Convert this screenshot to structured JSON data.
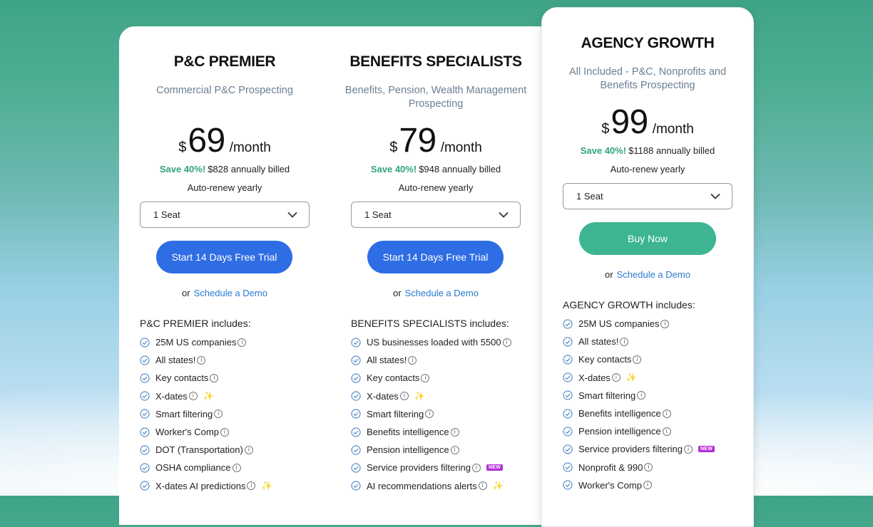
{
  "colors": {
    "save_green": "#2ea37e",
    "link_blue": "#2a7ad0",
    "cta_blue": "#2f6de5",
    "cta_green": "#3db592",
    "new_badge": "#b030d8",
    "check_blue": "#5a8fc8"
  },
  "plans": [
    {
      "name": "P&C PREMIER",
      "subtitle": "Commercial P&C Prospecting",
      "currency": "$",
      "amount": "69",
      "period": "/month",
      "save": "Save 40%!",
      "billed": "$828 annually billed",
      "renew": "Auto-renew yearly",
      "seat": "1 Seat",
      "cta": "Start 14 Days Free Trial",
      "demo_or": "or",
      "demo_link": "Schedule a Demo",
      "includes_title": "P&C PREMIER includes:",
      "features": [
        {
          "label": "25M US companies",
          "info": "i"
        },
        {
          "label": "All states!",
          "info": "i"
        },
        {
          "label": "Key contacts",
          "info": "i"
        },
        {
          "label": "X-dates",
          "info": "i",
          "spark": "✨"
        },
        {
          "label": "Smart filtering",
          "info": "i"
        },
        {
          "label": "Worker's Comp",
          "info": "i"
        },
        {
          "label": "DOT (Transportation)",
          "info": "i"
        },
        {
          "label": "OSHA compliance",
          "info": "i"
        },
        {
          "label": "X-dates AI predictions",
          "info": "i",
          "spark": "✨"
        }
      ]
    },
    {
      "name": "BENEFITS SPECIALISTS",
      "subtitle": "Benefits, Pension, Wealth Management Prospecting",
      "currency": "$",
      "amount": "79",
      "period": "/month",
      "save": "Save 40%!",
      "billed": "$948 annually billed",
      "renew": "Auto-renew yearly",
      "seat": "1 Seat",
      "cta": "Start 14 Days Free Trial",
      "demo_or": "or",
      "demo_link": "Schedule a Demo",
      "includes_title": "BENEFITS SPECIALISTS includes:",
      "features": [
        {
          "label": "US businesses loaded with 5500",
          "info": "i"
        },
        {
          "label": "All states!",
          "info": "i"
        },
        {
          "label": "Key contacts",
          "info": "i"
        },
        {
          "label": "X-dates",
          "info": "i",
          "spark": "✨"
        },
        {
          "label": "Smart filtering",
          "info": "i"
        },
        {
          "label": "Benefits intelligence",
          "info": "i"
        },
        {
          "label": "Pension intelligence",
          "info": "i"
        },
        {
          "label": "Service providers filtering",
          "info": "i",
          "badge": "NEW"
        },
        {
          "label": "AI recommendations alerts",
          "info": "i",
          "spark": "✨"
        }
      ]
    },
    {
      "name": "AGENCY GROWTH",
      "subtitle": "All Included - P&C, Nonprofits and Benefits Prospecting",
      "currency": "$",
      "amount": "99",
      "period": "/month",
      "save": "Save 40%!",
      "billed": "$1188 annually billed",
      "renew": "Auto-renew yearly",
      "seat": "1 Seat",
      "cta": "Buy Now",
      "demo_or": "or",
      "demo_link": "Schedule a Demo",
      "includes_title": "AGENCY GROWTH includes:",
      "features": [
        {
          "label": "25M US companies",
          "info": "i"
        },
        {
          "label": "All states!",
          "info": "i"
        },
        {
          "label": "Key contacts",
          "info": "i"
        },
        {
          "label": "X-dates",
          "info": "i",
          "spark": "✨"
        },
        {
          "label": "Smart filtering",
          "info": "i"
        },
        {
          "label": "Benefits intelligence",
          "info": "i"
        },
        {
          "label": "Pension intelligence",
          "info": "i"
        },
        {
          "label": "Service providers filtering",
          "info": "i",
          "badge": "NEW"
        },
        {
          "label": "Nonprofit & 990",
          "info": "i"
        },
        {
          "label": "Worker's Comp",
          "info": "i"
        }
      ]
    }
  ]
}
